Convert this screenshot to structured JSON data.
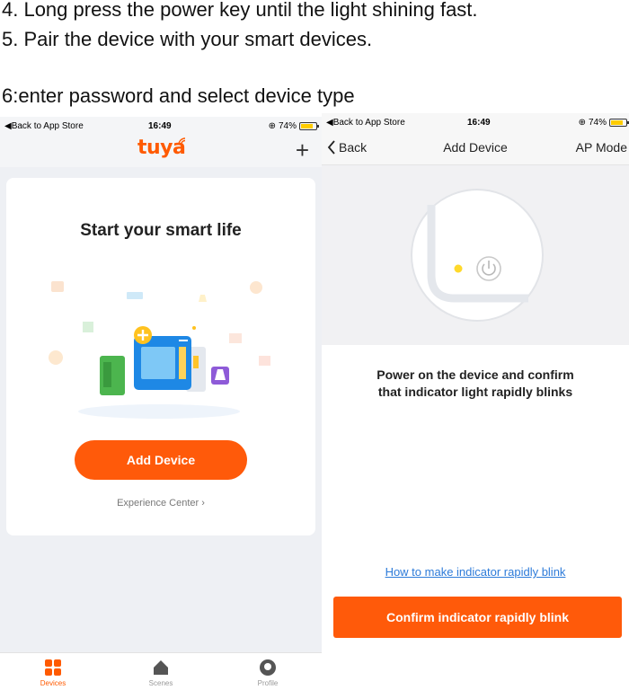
{
  "doc": {
    "line4": "4. Long press the power key until the light shining fast.",
    "line5": "5. Pair the device with your smart devices.",
    "line6": "6:enter password and select device type"
  },
  "status_bar": {
    "back_to_store": "Back to App Store",
    "time": "16:49",
    "battery": "74%"
  },
  "left_screen": {
    "logo": "tuya",
    "card_title": "Start your smart life",
    "add_device_button": "Add Device",
    "experience_center": "Experience Center",
    "tabs": [
      {
        "label": "Devices",
        "active": true,
        "icon": "grid-icon"
      },
      {
        "label": "Scenes",
        "active": false,
        "icon": "home-icon"
      },
      {
        "label": "Profile",
        "active": false,
        "icon": "profile-icon"
      }
    ]
  },
  "right_screen": {
    "nav_back": "Back",
    "nav_title": "Add Device",
    "nav_right": "AP Mode",
    "tip_line1": "Power on the device and confirm",
    "tip_line2": "that indicator light rapidly blinks",
    "help_link": "How to make indicator rapidly blink",
    "confirm_button": "Confirm indicator rapidly blink"
  },
  "colors": {
    "accent": "#ff5a0a",
    "link": "#2d7bd9",
    "indicator": "#ffd92b"
  }
}
